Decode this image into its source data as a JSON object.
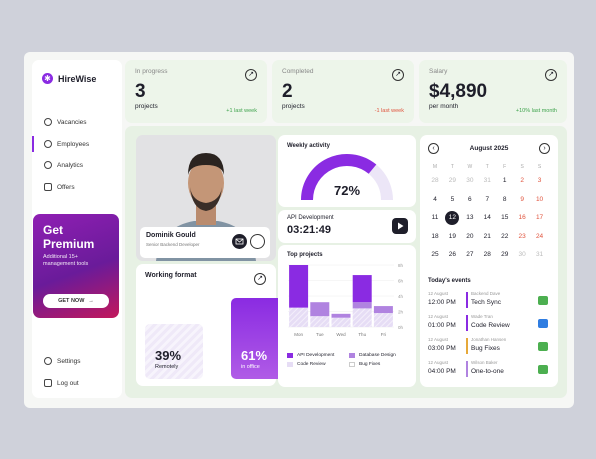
{
  "brand": {
    "name": "HireWise",
    "logo": "✱"
  },
  "nav": [
    {
      "label": "Vacancies",
      "icon": "clock-icon"
    },
    {
      "label": "Employees",
      "icon": "users-icon"
    },
    {
      "label": "Analytics",
      "icon": "analytics-icon"
    },
    {
      "label": "Offers",
      "icon": "offers-icon"
    }
  ],
  "promo": {
    "title1": "Get",
    "title2": "Premium",
    "subtitle": "Additional 15+ management tools",
    "button": "GET NOW",
    "button_arrow": "→"
  },
  "footer_nav": [
    {
      "label": "Settings",
      "icon": "gear-icon"
    },
    {
      "label": "Log out",
      "icon": "logout-icon"
    }
  ],
  "stats": [
    {
      "label": "In progress",
      "value": "3",
      "unit": "projects",
      "change": "+1 last week",
      "change_color": "#3fa34d"
    },
    {
      "label": "Completed",
      "value": "2",
      "unit": "projects",
      "change": "-1 last week",
      "change_color": "#e0533c"
    },
    {
      "label": "Salary",
      "value": "$4,890",
      "unit": "per month",
      "change": "+10% last month",
      "change_color": "#3fa34d"
    }
  ],
  "arrow_glyph": "↗",
  "profile": {
    "name": "Dominik Gould",
    "role": "Senior Backend Developer"
  },
  "working_format": {
    "title": "Working format",
    "remote_pct": "39%",
    "remote_label": "Remotely",
    "office_pct": "61%",
    "office_label": "in office",
    "remote_value": 39,
    "office_value": 61
  },
  "weekly_activity": {
    "title": "Weekly activity",
    "value_text": "72%",
    "value": 72
  },
  "timer": {
    "label": "API Development",
    "time": "03:21:49"
  },
  "top_projects": {
    "title": "Top projects",
    "legend": [
      {
        "name": "API Development",
        "color": "#8a2be2"
      },
      {
        "name": "Database Design",
        "color": "#b083e0"
      },
      {
        "name": "Code Review",
        "color": "#e6ddf5"
      },
      {
        "name": "Bug Fixes",
        "color": "#ffffff"
      }
    ]
  },
  "chart_data": {
    "type": "bar",
    "stacked": true,
    "categories": [
      "Mon",
      "Tue",
      "Wed",
      "Thu",
      "Fri"
    ],
    "y_ticks": [
      "8h",
      "6h",
      "4h",
      "2h",
      "0h"
    ],
    "ylim": [
      0,
      8
    ],
    "series": [
      {
        "name": "API Development",
        "values": [
          5.5,
          0,
          0,
          3.5,
          0
        ]
      },
      {
        "name": "Database Design",
        "values": [
          0,
          1.8,
          0.5,
          0.8,
          0.9
        ]
      },
      {
        "name": "Code Review",
        "values": [
          2.5,
          1.4,
          1.2,
          2.4,
          1.8
        ]
      },
      {
        "name": "Bug Fixes",
        "values": [
          0,
          0,
          0,
          0,
          0
        ]
      }
    ]
  },
  "calendar": {
    "month": "August 2025",
    "weekdays": [
      "M",
      "T",
      "W",
      "T",
      "F",
      "S",
      "S"
    ],
    "rows": [
      [
        "28",
        "29",
        "30",
        "31",
        "1",
        "2",
        "3"
      ],
      [
        "4",
        "5",
        "6",
        "7",
        "8",
        "9",
        "10"
      ],
      [
        "11",
        "12",
        "13",
        "14",
        "15",
        "16",
        "17"
      ],
      [
        "18",
        "19",
        "20",
        "21",
        "22",
        "23",
        "24"
      ],
      [
        "25",
        "26",
        "27",
        "28",
        "29",
        "30",
        "31"
      ]
    ],
    "selected": "12"
  },
  "events": {
    "title": "Today's events",
    "items": [
      {
        "date": "12 August",
        "time": "12:00 PM",
        "who": "Backend Dave",
        "name": "Tech Sync",
        "color": "#8a2be2"
      },
      {
        "date": "12 August",
        "time": "01:00 PM",
        "who": "Wade Tran",
        "name": "Code Review",
        "color": "#8a2be2"
      },
      {
        "date": "12 August",
        "time": "03:00 PM",
        "who": "Jonathan Hansen",
        "name": "Bug Fixes",
        "color": "#e6a93a"
      },
      {
        "date": "12 August",
        "time": "04:00 PM",
        "who": "Wilson Baker",
        "name": "One-to-one",
        "color": "#b083e0"
      }
    ]
  }
}
